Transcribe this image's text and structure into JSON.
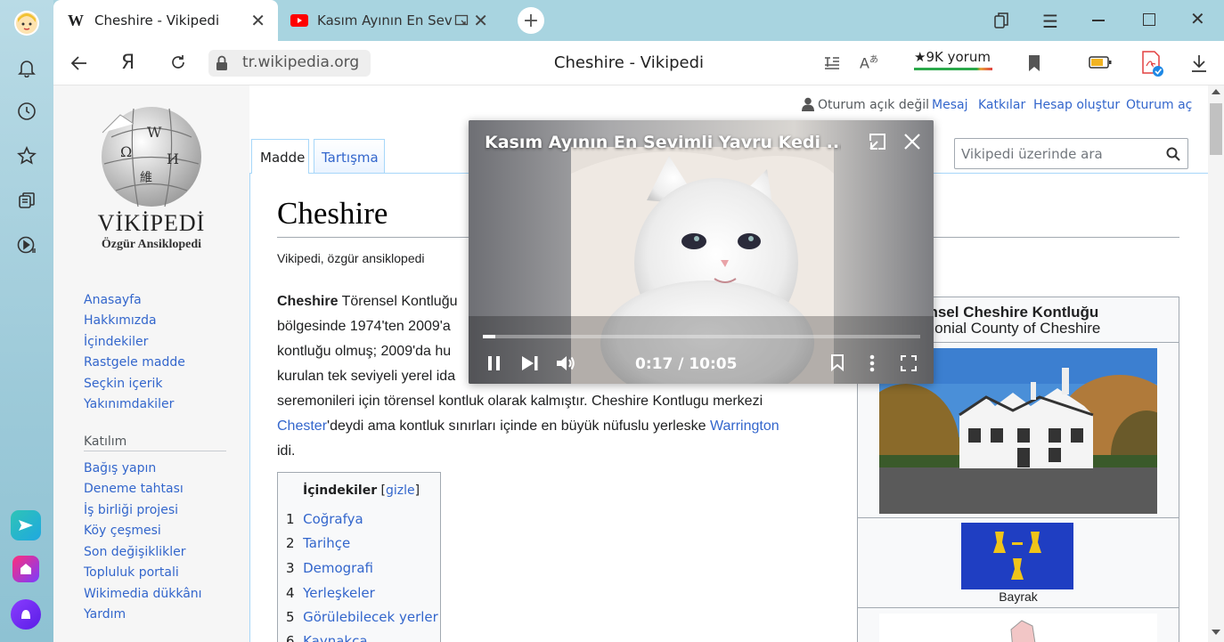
{
  "browser": {
    "tabs": [
      {
        "title": "Cheshire - Vikipedi",
        "favicon": "W"
      },
      {
        "title": "Kasım Ayının En Sevimli Yavru Kedi"
      }
    ],
    "address": "tr.wikipedia.org",
    "page_title": "Cheshire - Vikipedi",
    "reviews": "★9K yorum"
  },
  "wiki": {
    "logo_title": "VİKİPEDİ",
    "logo_subtitle": "Özgür Ansiklopedi",
    "user_bar": {
      "not_logged": "Oturum açık değil",
      "links": [
        "Mesaj",
        "Katkılar",
        "Hesap oluştur",
        "Oturum aç"
      ]
    },
    "tabs": [
      "Madde",
      "Tartışma"
    ],
    "search_placeholder": "Vikipedi üzerinde ara",
    "nav": [
      "Anasayfa",
      "Hakkımızda",
      "İçindekiler",
      "Rastgele madde",
      "Seçkin içerik",
      "Yakınımdakiler"
    ],
    "participation_heading": "Katılım",
    "participation": [
      "Bağış yapın",
      "Deneme tahtası",
      "İş birliği projesi",
      "Köy çeşmesi",
      "Son değişiklikler",
      "Topluluk portali",
      "Wikimedia dükkânı",
      "Yardım"
    ],
    "article": {
      "title": "Cheshire",
      "tagline": "Vikipedi, özgür ansiklopedi",
      "intro_bold": "Cheshire",
      "line1": " Törensel Kontluğu",
      "line2": "bölgesinde 1974'ten 2009'a",
      "line3": "kontluğu olmuş; 2009'da hu",
      "line4": "kurulan tek seviyeli yerel ida",
      "line5": "seremonileri için törensel kontluk olarak kalmıştır. Cheshire Kontlugu merkezi",
      "line6_link": "Chester",
      "line6_rest": "'deydi ama kontluk sınırları içinde en büyük nüfuslu yerleske ",
      "line6_link2": "Warrington",
      "line7": "idi."
    },
    "toc": {
      "title": "İçindekiler",
      "toggle": "gizle",
      "items": [
        {
          "num": "1",
          "label": "Coğrafya"
        },
        {
          "num": "2",
          "label": "Tarihçe"
        },
        {
          "num": "3",
          "label": "Demografi"
        },
        {
          "num": "4",
          "label": "Yerleşkeler"
        },
        {
          "num": "5",
          "label": "Görülebilecek yerler"
        },
        {
          "num": "6",
          "label": "Kaynakça"
        }
      ]
    },
    "infobox": {
      "title_line1": "ensel Cheshire Kontluğu",
      "title_line2": "monial County of Cheshire",
      "flag_caption": "Bayrak"
    }
  },
  "video": {
    "title": "Kasım Ayının En Sevimli Yavru Kedi ...",
    "time": "0:17 / 10:05",
    "progress": 0.028
  }
}
